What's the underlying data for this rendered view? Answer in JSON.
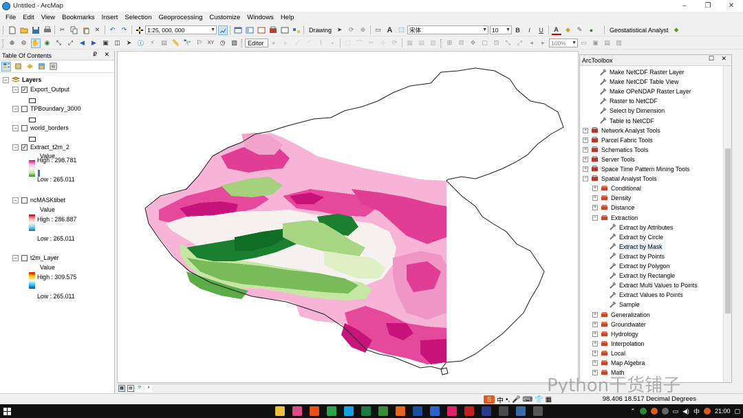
{
  "window": {
    "title": "Untitled - ArcMap",
    "minimize": "–",
    "maximize": "❐",
    "close": "✕"
  },
  "menu": [
    "File",
    "Edit",
    "View",
    "Bookmarks",
    "Insert",
    "Selection",
    "Geoprocessing",
    "Customize",
    "Windows",
    "Help"
  ],
  "toolbar": {
    "scale_value": "1:25, 000, 000",
    "drawing_label": "Drawing",
    "font_name": "宋体",
    "font_size": "10",
    "bold": "B",
    "italic": "I",
    "underline": "U",
    "text_tool": "A",
    "geostat_label": "Geostatistical Analyst",
    "editor_label": "Editor",
    "zoom_value": "100%"
  },
  "toc": {
    "title": "Table Of Contents",
    "controls": "₽ ✕",
    "root_label": "Layers",
    "layers": [
      {
        "name": "Export_Output",
        "checked": true,
        "type": "polygon"
      },
      {
        "name": "TPBoundary_3000",
        "checked": false,
        "type": "polygon"
      },
      {
        "name": "world_borders",
        "checked": false,
        "type": "polygon"
      },
      {
        "name": "Extract_t2m_2",
        "checked": true,
        "type": "raster",
        "value_label": "Value",
        "high": "High : 298.781",
        "low": "Low : 265.011",
        "ramp": [
          "#d6007a",
          "#f7b6dc",
          "#f5f5f5",
          "#c9e8a8",
          "#2e8a2c"
        ]
      },
      {
        "name": "ncMASKtibet",
        "checked": false,
        "type": "raster",
        "value_label": "Value",
        "high": "High : 286.887",
        "low": "Low : 265.011",
        "ramp": [
          "#a8002c",
          "#f4a6a0",
          "#f7f7f7",
          "#8fd1e8",
          "#0072b8"
        ]
      },
      {
        "name": "t2m_Layer",
        "checked": false,
        "type": "raster",
        "value_label": "Value",
        "high": "High : 309.575",
        "low": "Low : 265.011",
        "ramp": [
          "#e00000",
          "#ffd400",
          "#ffffff",
          "#36c6f0",
          "#0050c8"
        ]
      }
    ]
  },
  "toolbox": {
    "title": "ArcToolbox",
    "controls": "☐ ✕",
    "items": [
      {
        "label": "Make NetCDF Raster Layer",
        "kind": "tool",
        "level": 2
      },
      {
        "label": "Make NetCDF Table View",
        "kind": "tool",
        "level": 2
      },
      {
        "label": "Make OPeNDAP Raster Layer",
        "kind": "tool",
        "level": 2
      },
      {
        "label": "Raster to NetCDF",
        "kind": "tool",
        "level": 2
      },
      {
        "label": "Select by Dimension",
        "kind": "tool",
        "level": 2
      },
      {
        "label": "Table to NetCDF",
        "kind": "tool",
        "level": 2
      },
      {
        "label": "Network Analyst Tools",
        "kind": "box",
        "level": 0,
        "exp": "+"
      },
      {
        "label": "Parcel Fabric Tools",
        "kind": "box",
        "level": 0,
        "exp": "+"
      },
      {
        "label": "Schematics Tools",
        "kind": "box",
        "level": 0,
        "exp": "+"
      },
      {
        "label": "Server Tools",
        "kind": "box",
        "level": 0,
        "exp": "+"
      },
      {
        "label": "Space Time Pattern Mining Tools",
        "kind": "box",
        "level": 0,
        "exp": "+"
      },
      {
        "label": "Spatial Analyst Tools",
        "kind": "box",
        "level": 0,
        "exp": "−"
      },
      {
        "label": "Conditional",
        "kind": "set",
        "level": 1,
        "exp": "+"
      },
      {
        "label": "Density",
        "kind": "set",
        "level": 1,
        "exp": "+"
      },
      {
        "label": "Distance",
        "kind": "set",
        "level": 1,
        "exp": "+"
      },
      {
        "label": "Extraction",
        "kind": "set",
        "level": 1,
        "exp": "−"
      },
      {
        "label": "Extract by Attributes",
        "kind": "tool",
        "level": 3
      },
      {
        "label": "Extract by Circle",
        "kind": "tool",
        "level": 3
      },
      {
        "label": "Extract by Mask",
        "kind": "tool",
        "level": 3,
        "selected": true
      },
      {
        "label": "Extract by Points",
        "kind": "tool",
        "level": 3
      },
      {
        "label": "Extract by Polygon",
        "kind": "tool",
        "level": 3
      },
      {
        "label": "Extract by Rectangle",
        "kind": "tool",
        "level": 3
      },
      {
        "label": "Extract Multi Values to Points",
        "kind": "tool",
        "level": 3
      },
      {
        "label": "Extract Values to Points",
        "kind": "tool",
        "level": 3
      },
      {
        "label": "Sample",
        "kind": "tool",
        "level": 3
      },
      {
        "label": "Generalization",
        "kind": "set",
        "level": 1,
        "exp": "+"
      },
      {
        "label": "Groundwater",
        "kind": "set",
        "level": 1,
        "exp": "+"
      },
      {
        "label": "Hydrology",
        "kind": "set",
        "level": 1,
        "exp": "+"
      },
      {
        "label": "Interpolation",
        "kind": "set",
        "level": 1,
        "exp": "+"
      },
      {
        "label": "Local",
        "kind": "set",
        "level": 1,
        "exp": "+"
      },
      {
        "label": "Map Algebra",
        "kind": "set",
        "level": 1,
        "exp": "+"
      },
      {
        "label": "Math",
        "kind": "set",
        "level": 1,
        "exp": "+"
      }
    ]
  },
  "status": {
    "coords": "98.406  18.517 Decimal Degrees"
  },
  "ime": {
    "logo": "S",
    "lang": "中"
  },
  "watermark": "Python干货铺子",
  "taskbar": {
    "time": "21:00"
  },
  "colors": {
    "pink_dark": "#c8137a",
    "pink_mid": "#e8449c",
    "pink_light": "#f7b4d6",
    "green_dark": "#1a7f2e",
    "green_mid": "#5aad45",
    "green_light": "#c6e6a4"
  }
}
